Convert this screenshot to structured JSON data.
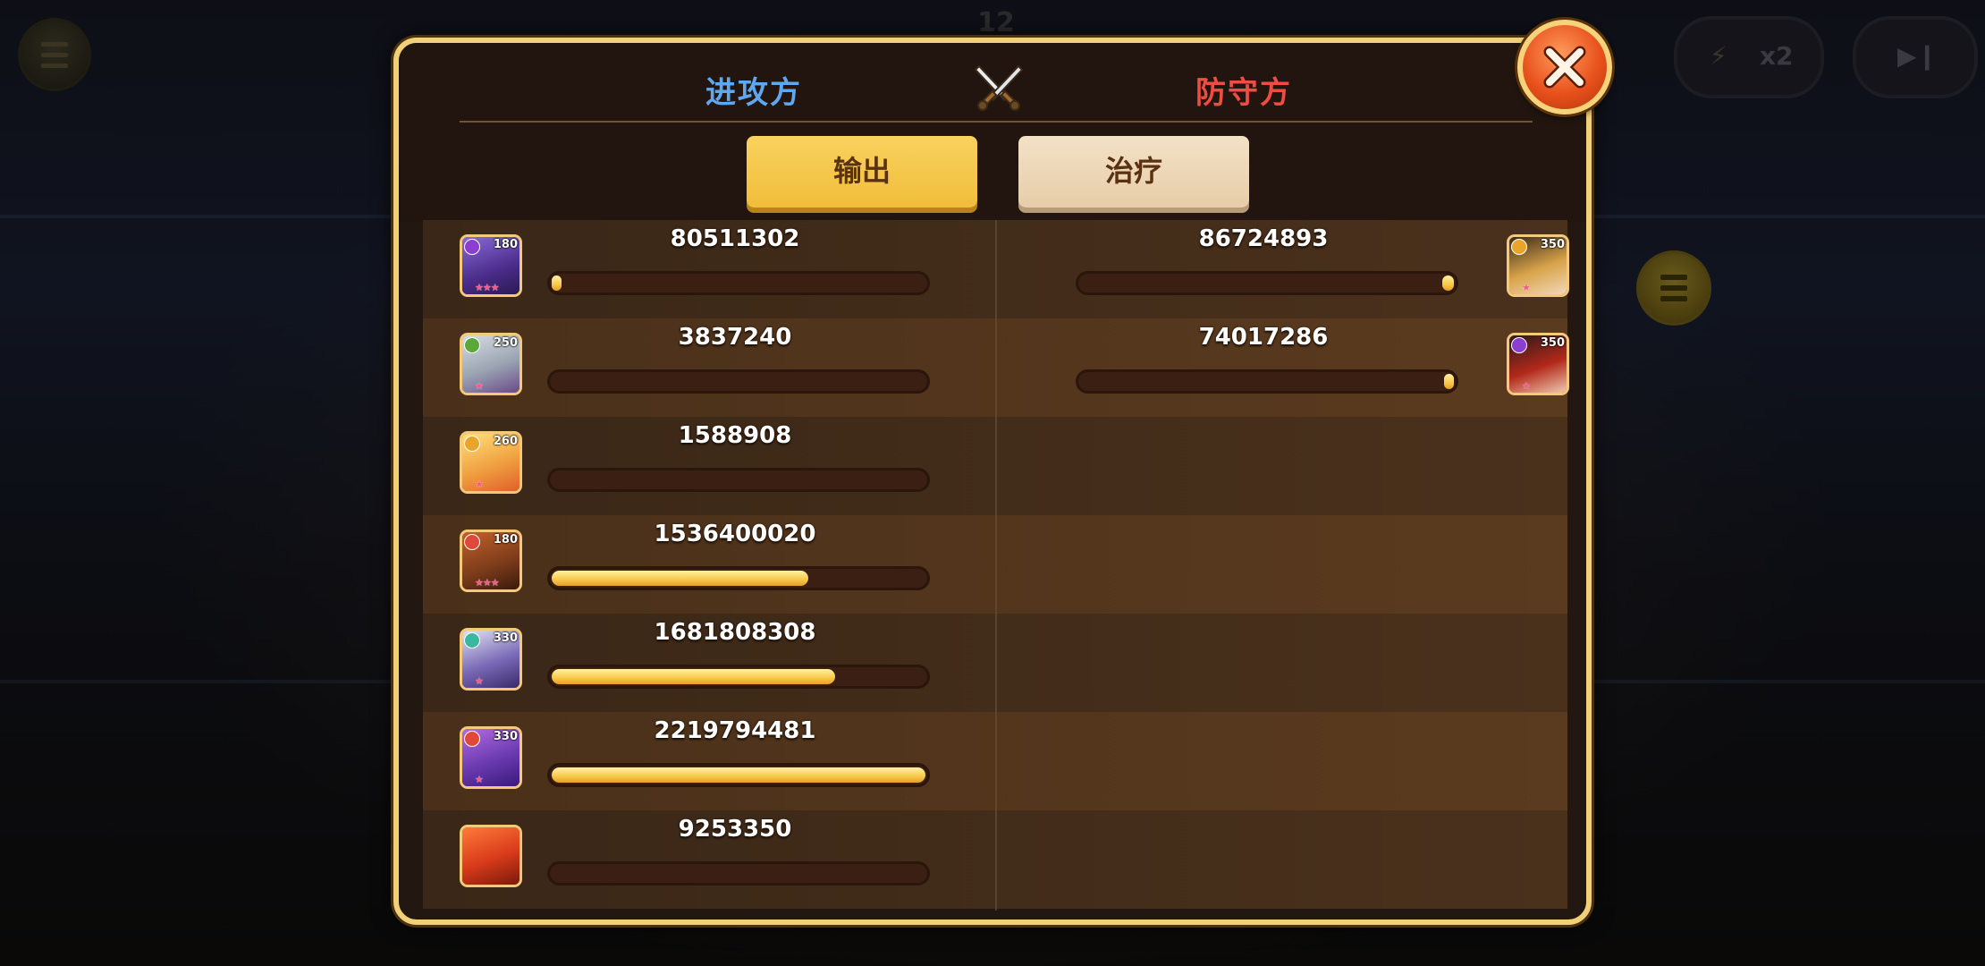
{
  "header": {
    "attacker_label": "进攻方",
    "defender_label": "防守方",
    "crossed_swords_icon": "crossed-swords-icon"
  },
  "tabs": [
    {
      "label": "输出",
      "selected": true
    },
    {
      "label": "治疗",
      "selected": false
    }
  ],
  "attackers": [
    {
      "value": "80511302",
      "level": "180",
      "fill": 0.02,
      "element": "dark",
      "stars": 3,
      "hero_icon": "dark-beast-hero-icon"
    },
    {
      "value": "3837240",
      "level": "250",
      "fill": 0.0,
      "element": "forest",
      "stars": 1,
      "hero_icon": "silver-valkyrie-hero-icon"
    },
    {
      "value": "1588908",
      "level": "260",
      "fill": 0.0,
      "element": "light",
      "stars": 1,
      "hero_icon": "golden-angel-hero-icon"
    },
    {
      "value": "1536400020",
      "level": "180",
      "fill": 0.69,
      "element": "fire",
      "stars": 3,
      "hero_icon": "brown-bear-hero-icon"
    },
    {
      "value": "1681808308",
      "level": "330",
      "fill": 0.76,
      "element": "void",
      "stars": 1,
      "hero_icon": "ghost-wraith-hero-icon"
    },
    {
      "value": "2219794481",
      "level": "330",
      "fill": 1.0,
      "element": "fire",
      "stars": 1,
      "hero_icon": "purple-dragon-hero-icon"
    },
    {
      "value": "9253350",
      "level": "",
      "fill": 0.0,
      "element": "",
      "stars": 0,
      "hero_icon": "phoenix-hero-icon"
    }
  ],
  "defenders": [
    {
      "value": "86724893",
      "level": "350",
      "fill": 0.04,
      "element": "light",
      "stars": 1,
      "hero_icon": "golden-sorceress-hero-icon"
    },
    {
      "value": "74017286",
      "level": "350",
      "fill": 0.03,
      "element": "dark",
      "stars": 1,
      "hero_icon": "crimson-witch-hero-icon"
    }
  ],
  "background": {
    "round_counter": "12",
    "speed_label": "x2"
  },
  "colors": {
    "attacker_blue": "#5fa8ef",
    "defender_red": "#ef4d42",
    "panel_border": "#f2d078",
    "bar_fill": "#f8cc4e",
    "tab_active": "#f0bd3a",
    "tab_inactive": "#efdcbf"
  }
}
